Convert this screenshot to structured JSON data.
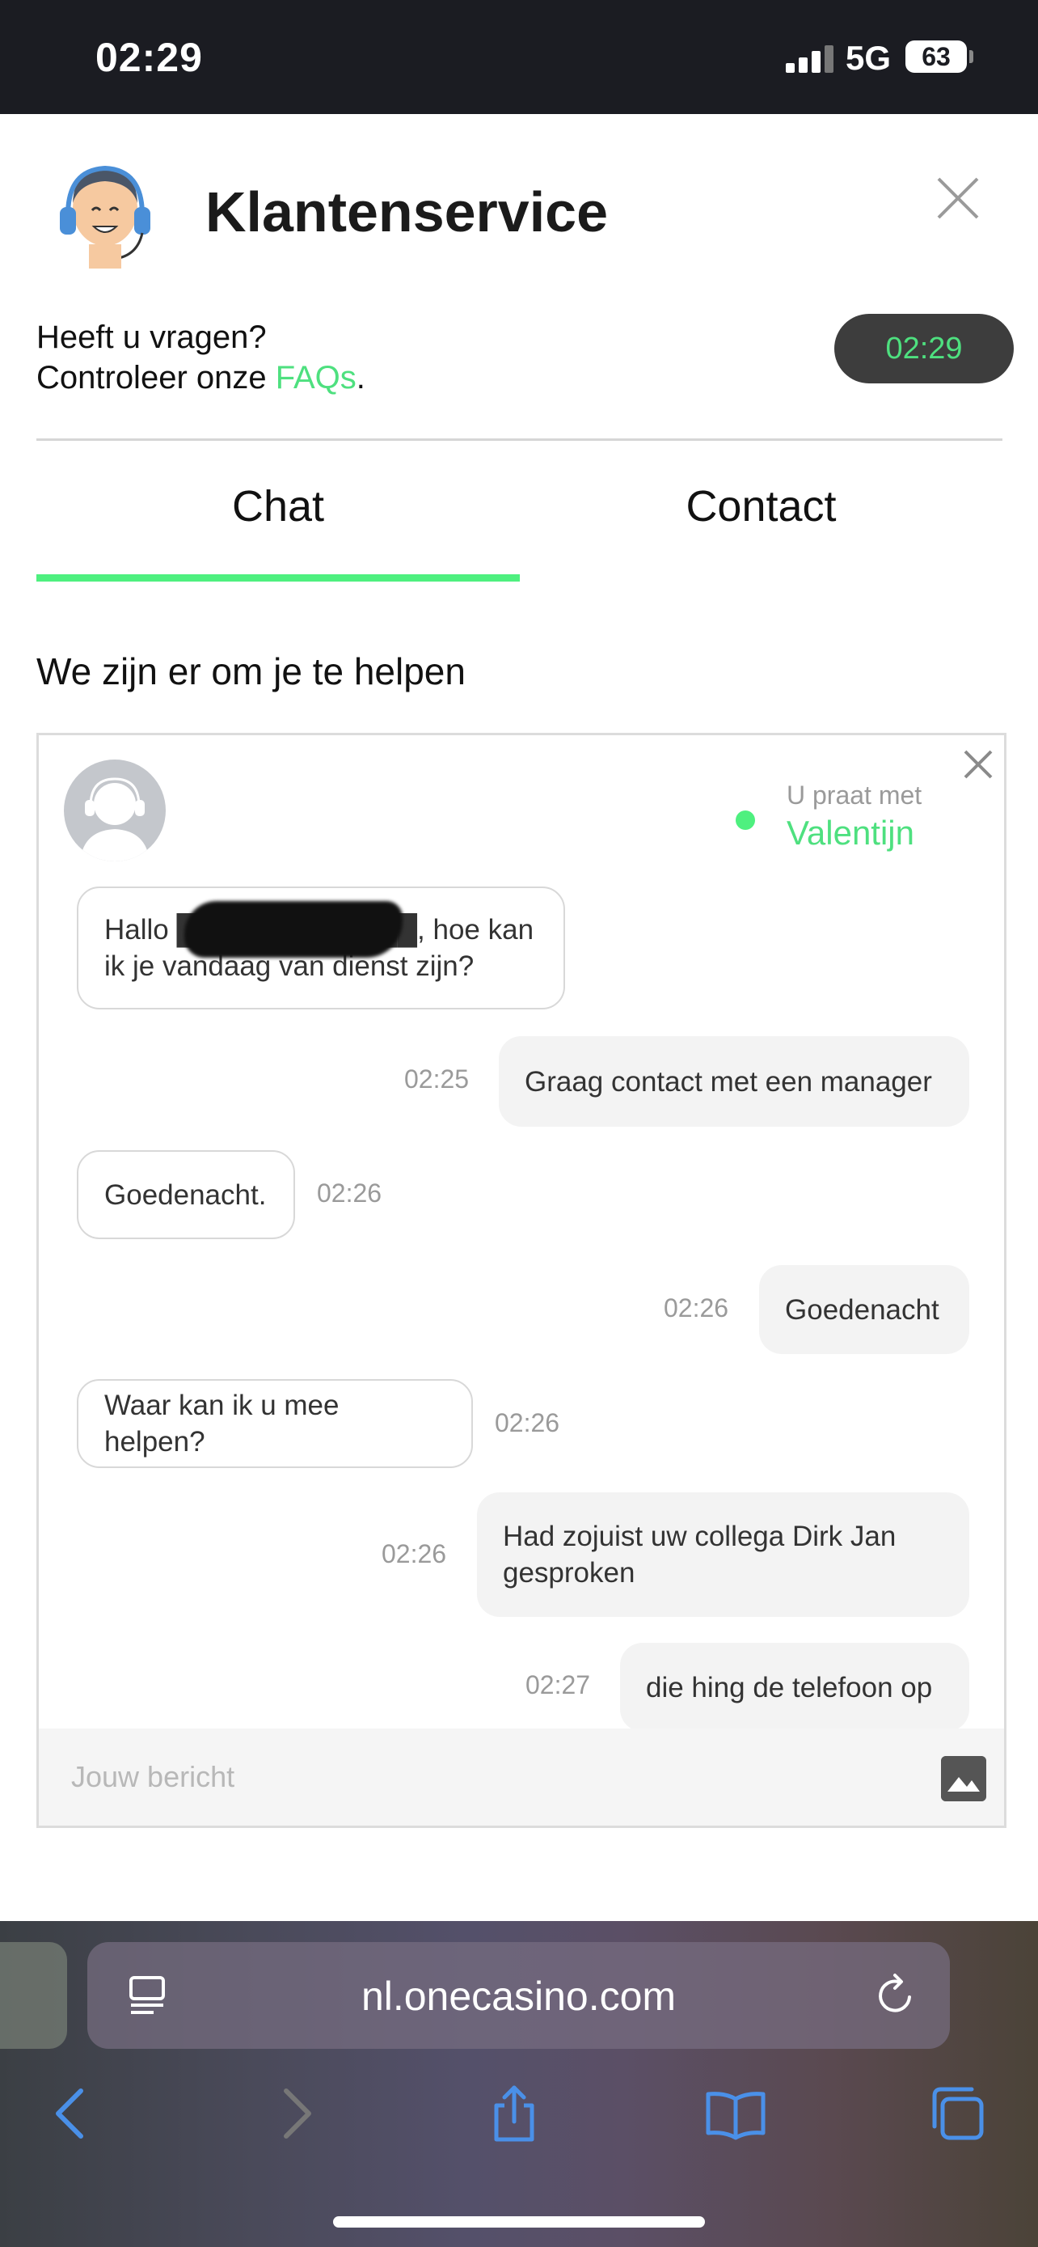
{
  "status_bar": {
    "time": "02:29",
    "network": "5G",
    "battery": "63"
  },
  "header": {
    "title": "Klantenservice",
    "question_line1": "Heeft u vragen?",
    "question_line2_prefix": "Controleer onze ",
    "faq_link": "FAQs",
    "question_line2_suffix": ".",
    "timer": "02:29"
  },
  "tabs": [
    {
      "label": "Chat",
      "active": true
    },
    {
      "label": "Contact",
      "active": false
    }
  ],
  "help_heading": "We zijn er om je te helpen",
  "chat": {
    "talking_with_label": "U praat met",
    "agent_name": "Valentijn",
    "messages": [
      {
        "from": "agent",
        "text": "Hallo ████████████, hoe kan ik je vandaag van dienst zijn?",
        "time": ""
      },
      {
        "from": "user",
        "text": "Graag contact met een manager",
        "time": "02:25"
      },
      {
        "from": "agent",
        "text": "Goedenacht.",
        "time": "02:26"
      },
      {
        "from": "user",
        "text": "Goedenacht",
        "time": "02:26"
      },
      {
        "from": "agent",
        "text": "Waar kan ik u mee helpen?",
        "time": "02:26"
      },
      {
        "from": "user",
        "text": "Had zojuist uw collega Dirk Jan gesproken",
        "time": "02:26"
      },
      {
        "from": "user",
        "text": "die hing de telefoon op",
        "time": "02:27"
      }
    ],
    "input_placeholder": "Jouw bericht"
  },
  "browser": {
    "url": "nl.onecasino.com"
  },
  "colors": {
    "accent": "#4ef07f",
    "dark": "#1b1c22",
    "timer_bg": "#3d3d3d"
  }
}
